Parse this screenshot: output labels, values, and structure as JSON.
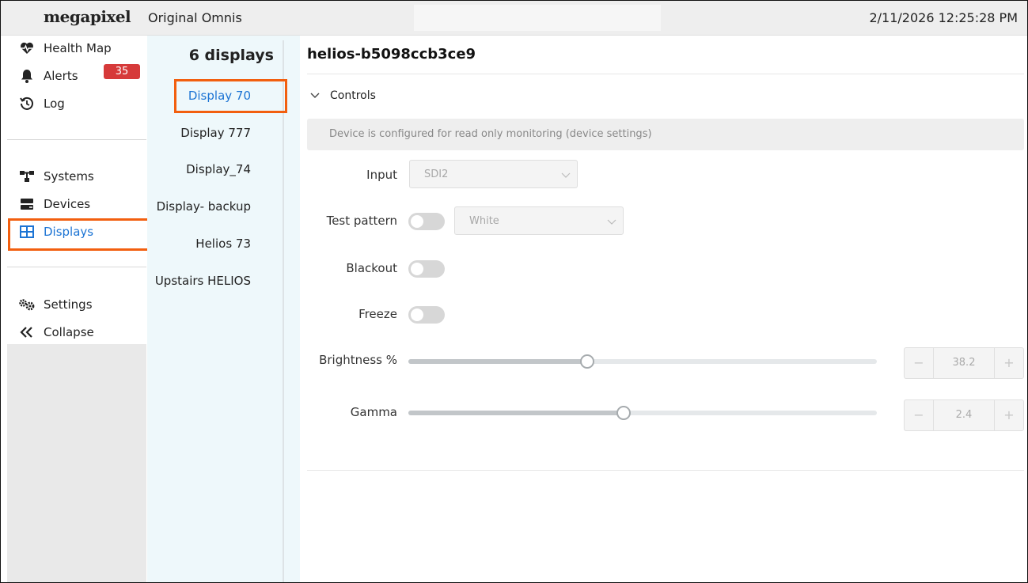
{
  "header": {
    "logo": "megapixel",
    "site_name": "Original Omnis",
    "datetime": "2/11/2026 12:25:28 PM"
  },
  "sidebar": {
    "group1": [
      {
        "label": "Health Map",
        "icon": "heart-pulse-icon"
      },
      {
        "label": "Alerts",
        "icon": "bell-icon",
        "badge": "35"
      },
      {
        "label": "Log",
        "icon": "history-icon"
      }
    ],
    "group2": [
      {
        "label": "Systems",
        "icon": "network-icon"
      },
      {
        "label": "Devices",
        "icon": "server-icon"
      },
      {
        "label": "Displays",
        "icon": "grid-icon",
        "active": true
      }
    ],
    "group3": [
      {
        "label": "Settings",
        "icon": "gears-icon"
      },
      {
        "label": "Collapse",
        "icon": "double-chevron-left-icon"
      }
    ]
  },
  "displays": {
    "title": "6 displays",
    "items": [
      "Display 70",
      "Display 777",
      "Display_74",
      "Display- backup",
      "Helios 73",
      "Upstairs HELIOS"
    ],
    "selected": "Display 70"
  },
  "device": {
    "title": "helios-b5098ccb3ce9",
    "controls_label": "Controls",
    "readonly_notice": "Device is configured for read only monitoring (device settings)",
    "input": {
      "label": "Input",
      "value": "SDI2"
    },
    "test_pattern": {
      "label": "Test pattern",
      "enabled": false,
      "value": "White"
    },
    "blackout": {
      "label": "Blackout",
      "enabled": false
    },
    "freeze": {
      "label": "Freeze",
      "enabled": false
    },
    "brightness": {
      "label": "Brightness %",
      "value": "38.2",
      "fraction": 0.382
    },
    "gamma": {
      "label": "Gamma",
      "value": "2.4",
      "fraction": 0.46
    }
  },
  "colors": {
    "accent": "#1c74d4",
    "highlight": "#f25f0f",
    "badge": "#d63a3a"
  }
}
